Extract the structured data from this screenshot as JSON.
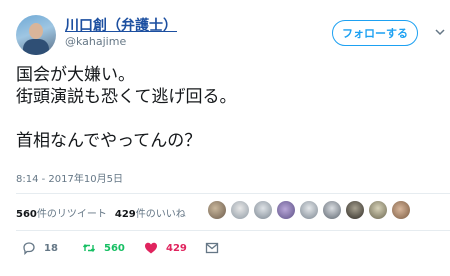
{
  "user": {
    "name": "川口創（弁護士）",
    "handle": "@kahajime"
  },
  "follow_button": {
    "label": "フォローする"
  },
  "tweet": {
    "line1": "国会が大嫌い。",
    "line2": "街頭演説も恐くて逃げ回る。",
    "line3": "首相なんでやってんの？"
  },
  "timestamp": "8:14 - 2017年10月5日",
  "stats": {
    "retweets_count": "560",
    "retweets_label": "件のリツイート",
    "likes_count": "429",
    "likes_label": "件のいいね"
  },
  "actions": {
    "reply_count": "18",
    "retweet_count": "560",
    "like_count": "429"
  },
  "colors": {
    "accent": "#1da1f2",
    "name": "#1c4fa0",
    "retweet": "#17bf63",
    "like": "#e0245e",
    "muted": "#657786"
  },
  "icons": [
    "reply-icon",
    "retweet-icon",
    "heart-icon",
    "dm-icon",
    "chevron-down-icon"
  ]
}
